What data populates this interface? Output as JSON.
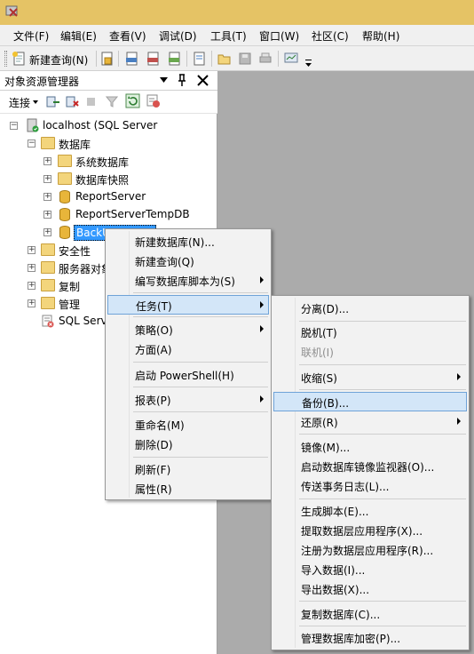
{
  "menubar": {
    "items": [
      "文件(F)",
      "编辑(E)",
      "查看(V)",
      "调试(D)",
      "工具(T)",
      "窗口(W)",
      "社区(C)",
      "帮助(H)"
    ]
  },
  "toolbar": {
    "new_query_label": "新建查询(N)"
  },
  "panel": {
    "title": "对象资源管理器",
    "connect_label": "连接"
  },
  "tree": {
    "server": "localhost (SQL Server",
    "databases": "数据库",
    "system_databases": "系统数据库",
    "snapshots": "数据库快照",
    "report_server": "ReportServer",
    "report_server_temp": "ReportServerTempDB",
    "selected_db": "BackUpTestDB",
    "security": "安全性",
    "server_objects": "服务器对象",
    "replication": "复制",
    "management": "管理",
    "agent": "SQL Serv"
  },
  "context_menu": {
    "new_database": "新建数据库(N)...",
    "new_query": "新建查询(Q)",
    "script_database_as": "编写数据库脚本为(S)",
    "tasks": "任务(T)",
    "policies": "策略(O)",
    "facets": "方面(A)",
    "powershell": "启动 PowerShell(H)",
    "reports": "报表(P)",
    "rename": "重命名(M)",
    "delete": "删除(D)",
    "refresh": "刷新(F)",
    "properties": "属性(R)"
  },
  "tasks_menu": {
    "detach": "分离(D)...",
    "take_offline": "脱机(T)",
    "bring_online": "联机(I)",
    "shrink": "收缩(S)",
    "backup": "备份(B)...",
    "restore": "还原(R)",
    "mirror": "镜像(M)...",
    "mirror_monitor": "启动数据库镜像监视器(O)...",
    "log_shipping": "传送事务日志(L)...",
    "generate_scripts": "生成脚本(E)...",
    "extract_dac": "提取数据层应用程序(X)...",
    "register_dac": "注册为数据层应用程序(R)...",
    "import_data": "导入数据(I)...",
    "export_data": "导出数据(X)...",
    "copy_database": "复制数据库(C)...",
    "manage_encryption": "管理数据库加密(P)..."
  }
}
